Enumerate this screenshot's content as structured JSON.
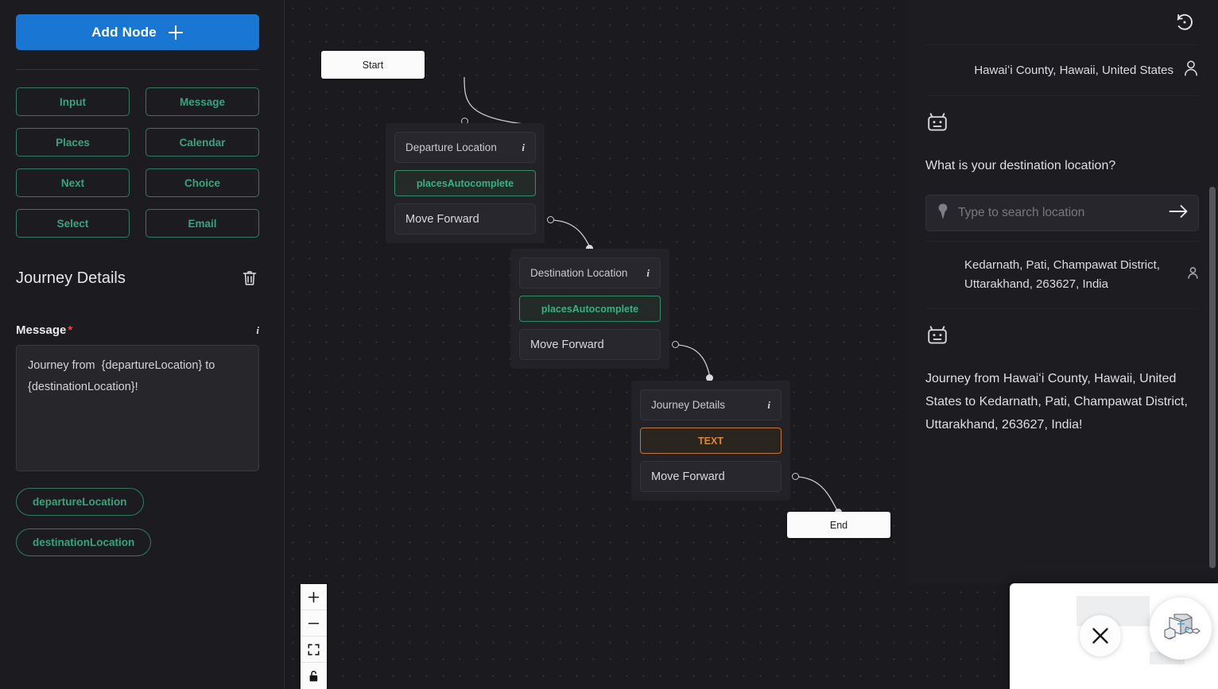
{
  "sidebar": {
    "add_node_label": "Add Node",
    "node_types": [
      {
        "label": "Input"
      },
      {
        "label": "Message"
      },
      {
        "label": "Places"
      },
      {
        "label": "Calendar"
      },
      {
        "label": "Next"
      },
      {
        "label": "Choice"
      },
      {
        "label": "Select"
      },
      {
        "label": "Email"
      }
    ],
    "panel_title": "Journey Details",
    "delete_icon": "trash-icon",
    "message_field": {
      "label": "Message",
      "required_marker": "*",
      "info_icon": "info-icon",
      "value": "Journey from  {departureLocation} to  {destinationLocation}!"
    },
    "variables": [
      {
        "label": "departureLocation"
      },
      {
        "label": "destinationLocation"
      }
    ]
  },
  "canvas": {
    "start_node": "Start",
    "end_node": "End",
    "nodes": [
      {
        "title": "Departure Location",
        "badge": "placesAutocomplete",
        "badge_style": "green",
        "action": "Move Forward",
        "info_icon": "info-icon"
      },
      {
        "title": "Destination Location",
        "badge": "placesAutocomplete",
        "badge_style": "green",
        "action": "Move Forward",
        "info_icon": "info-icon"
      },
      {
        "title": "Journey Details",
        "badge": "TEXT",
        "badge_style": "orange",
        "action": "Move Forward",
        "info_icon": "info-icon"
      }
    ],
    "controls": [
      {
        "name": "zoom-in-button",
        "icon": "plus-icon"
      },
      {
        "name": "zoom-out-button",
        "icon": "minus-icon"
      },
      {
        "name": "fit-view-button",
        "icon": "fit-screen-icon"
      },
      {
        "name": "lock-button",
        "icon": "lock-icon"
      }
    ]
  },
  "chat": {
    "restart_icon": "restart-history-icon",
    "messages": [
      {
        "role": "user",
        "text": "Hawaiʻi County, Hawaii, United States",
        "avatar": "user-avatar-icon"
      },
      {
        "role": "bot",
        "text": "What is your destination location?",
        "avatar": "robot-avatar-icon"
      },
      {
        "role": "user",
        "text": "Kedarnath, Pati, Champawat District, Uttarakhand, 263627, India",
        "avatar": "user-avatar-icon"
      },
      {
        "role": "bot",
        "text": "Journey from Hawaiʻi County, Hawaii, United States to Kedarnath, Pati, Champawat District, Uttarakhand, 263627, India!",
        "avatar": "robot-avatar-icon"
      }
    ],
    "search": {
      "placeholder": "Type to search location",
      "value": "",
      "pin_icon": "map-pin-icon",
      "submit_icon": "arrow-right-icon"
    }
  },
  "widget": {
    "close_icon": "close-icon",
    "bot_icon": "robot-cube-icon"
  },
  "colors": {
    "accent_blue": "#1976d2",
    "accent_green": "#36a47c",
    "accent_orange": "#e0862f",
    "required_red": "#e5484d"
  }
}
